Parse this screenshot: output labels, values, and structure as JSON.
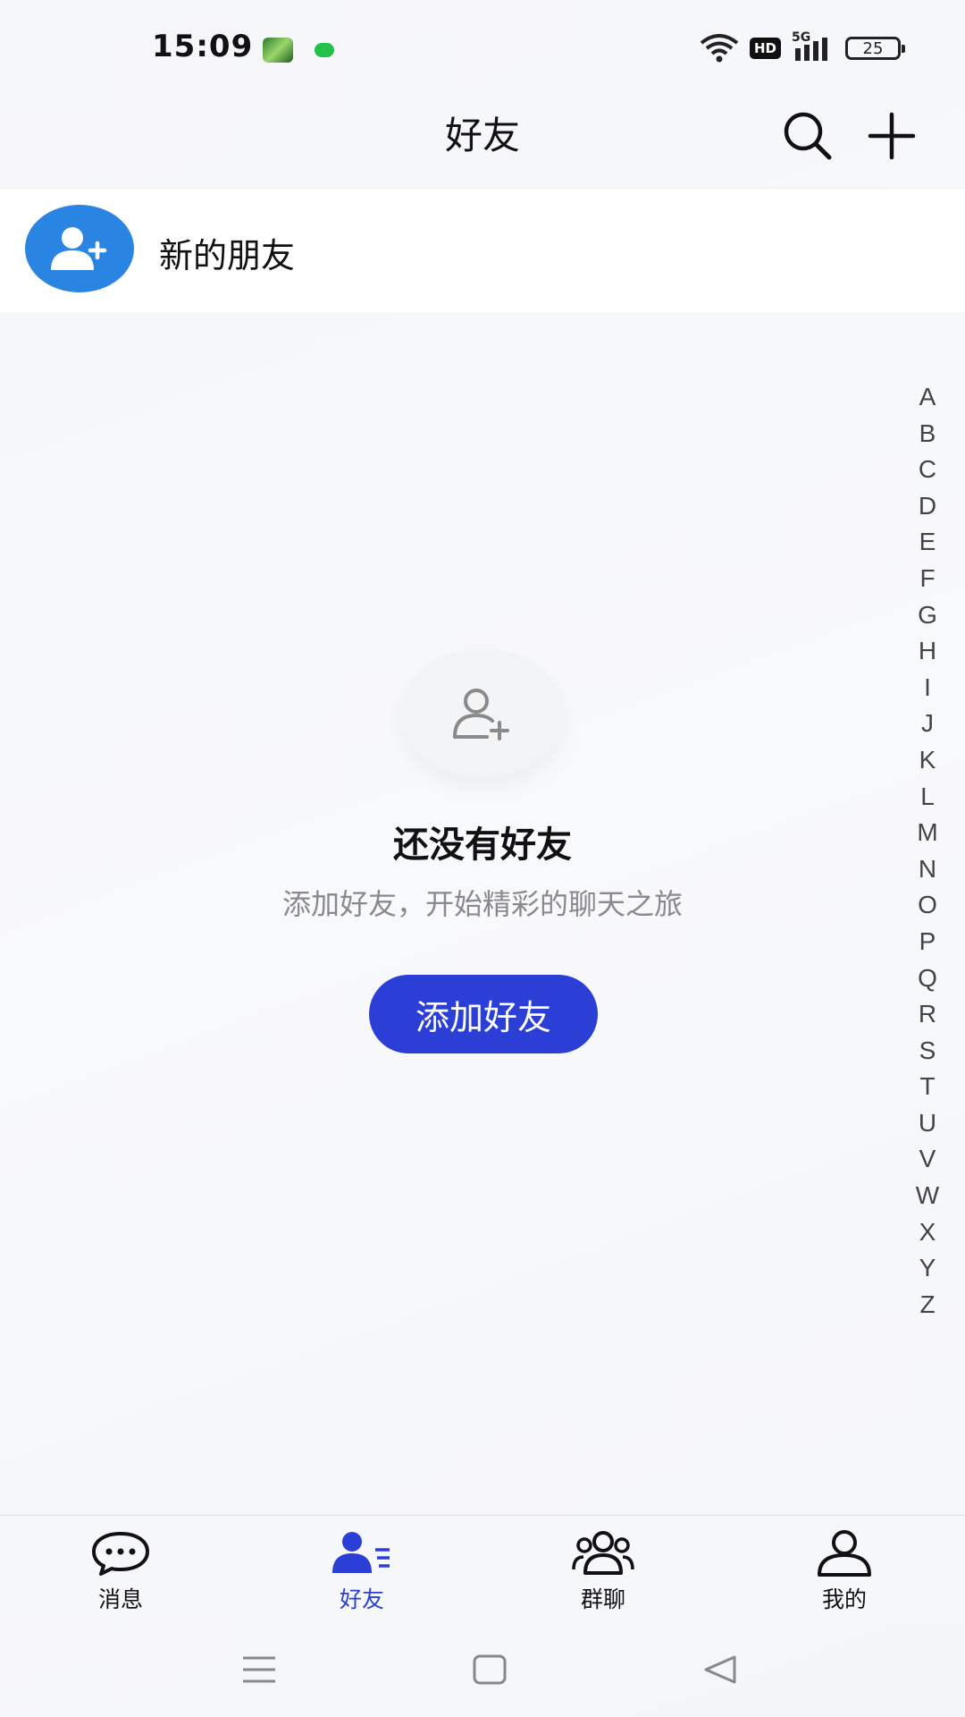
{
  "status_bar": {
    "time": "15:09",
    "hd": "HD",
    "network": "5G",
    "battery": "25"
  },
  "header": {
    "title": "好友"
  },
  "new_friends": {
    "label": "新的朋友"
  },
  "alphabet": [
    "A",
    "B",
    "C",
    "D",
    "E",
    "F",
    "G",
    "H",
    "I",
    "J",
    "K",
    "L",
    "M",
    "N",
    "O",
    "P",
    "Q",
    "R",
    "S",
    "T",
    "U",
    "V",
    "W",
    "X",
    "Y",
    "Z"
  ],
  "empty_state": {
    "title": "还没有好友",
    "subtitle": "添加好友，开始精彩的聊天之旅",
    "button_label": "添加好友"
  },
  "bottom_nav": {
    "items": [
      {
        "label": "消息",
        "icon": "chat-bubble-icon"
      },
      {
        "label": "好友",
        "icon": "friends-icon",
        "active": true
      },
      {
        "label": "群聊",
        "icon": "group-icon"
      },
      {
        "label": "我的",
        "icon": "profile-icon"
      }
    ]
  },
  "colors": {
    "accent": "#2b3ed6",
    "avatar_blue": "#2a85e2"
  }
}
